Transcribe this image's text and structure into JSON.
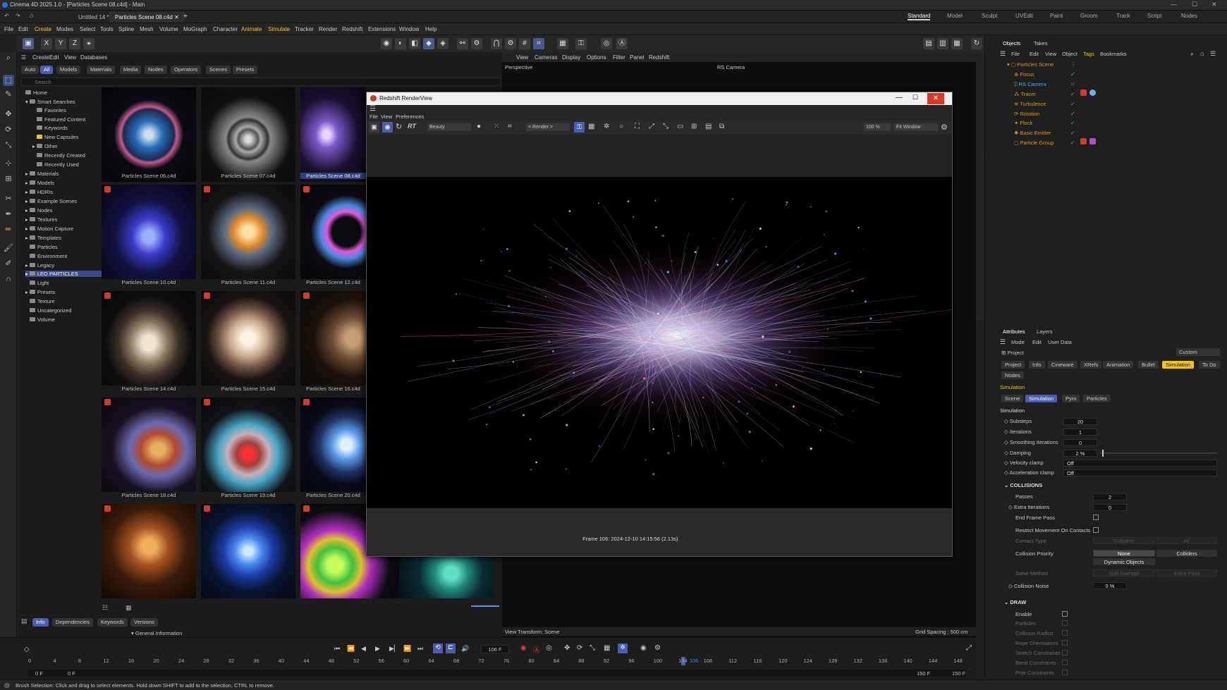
{
  "window": {
    "title": "Cinema 4D 2025.1.0 - [Particles Scene 08.c4d] - Main"
  },
  "doc_tabs": [
    "Untitled 14 *",
    "Particles Scene 08.c4d"
  ],
  "layouts": [
    "Standard",
    "Model",
    "Sculpt",
    "UVEdit",
    "Paint",
    "Groom",
    "Track",
    "Script",
    "Nodes"
  ],
  "menu": [
    "File",
    "Edit",
    "Create",
    "Modes",
    "Select",
    "Tools",
    "Spline",
    "Mesh",
    "Volume",
    "MoGraph",
    "Character",
    "Animate",
    "Simulate",
    "Tracker",
    "Render",
    "Redshift",
    "Extensions",
    "Window",
    "Help"
  ],
  "axis": {
    "x": "X",
    "y": "Y",
    "z": "Z"
  },
  "assets": {
    "menu": [
      "Create",
      "Edit",
      "View",
      "Databases"
    ],
    "filters": [
      "Auto",
      "All",
      "Models",
      "Materials",
      "Media",
      "Nodes",
      "Operators",
      "Scenes",
      "Presets"
    ],
    "search_placeholder": "Search",
    "tree": [
      "Home",
      "Smart Searches",
      "Favorites",
      "Featured Content",
      "Keywords",
      "New Capsules",
      "Other",
      "Recently Created",
      "Recently Used",
      "Materials",
      "Models",
      "HDRIs",
      "Example Scenes",
      "Nodes",
      "Textures",
      "Motion Capture",
      "Templates",
      "Particles",
      "Environment",
      "Legacy",
      "LEO PARTICLES",
      "Light",
      "Presets",
      "Texture",
      "Uncategorized",
      "Volume"
    ],
    "thumbs": [
      "Particles Scene 06.c4d",
      "Particles Scene 07.c4d",
      "Particles Scene 08.c4d",
      "Particles Scene 10.c4d",
      "Particles Scene 11.c4d",
      "Particles Scene 12.c4d",
      "Particles Scene 14.c4d",
      "Particles Scene 15.c4d",
      "Particles Scene 16.c4d",
      "Particles Scene 18.c4d",
      "Particles Scene 19.c4d",
      "Particles Scene 20.c4d"
    ],
    "info_tabs": [
      "Info",
      "Dependencies",
      "Keywords",
      "Versions"
    ],
    "general_info": "General Information"
  },
  "viewport": {
    "menu": [
      "View",
      "Cameras",
      "Display",
      "Options",
      "Filter",
      "Panel",
      "Redshift"
    ],
    "name": "Perspective",
    "camera": "RS Camera",
    "view_transform": "View Transform: Scene",
    "grid_spacing": "Grid Spacing : 500 cm"
  },
  "renderview": {
    "title": "Redshift RenderView",
    "menu": [
      "File",
      "View",
      "Preferences"
    ],
    "aov": "Beauty",
    "render_mode": "< Render >",
    "rt": "RT",
    "zoom": "100 %",
    "fit": "Fit Window",
    "frame_info": "Frame  106:  2024-12-10  14:15:56  (2.13s)"
  },
  "objects": {
    "tabs": [
      "Objects",
      "Takes"
    ],
    "menu": [
      "File",
      "Edit",
      "View",
      "Object",
      "Tags",
      "Bookmarks"
    ],
    "items": [
      "Particles Scene",
      "Focus",
      "RS Camera",
      "Tracer",
      "Turbulence",
      "Rotation",
      "Flock",
      "Basic Emitter",
      "Particle Group"
    ]
  },
  "attributes": {
    "tabs": [
      "Attributes",
      "Layers"
    ],
    "menu": [
      "Mode",
      "Edit",
      "User Data"
    ],
    "object": "Project",
    "preset": "Custom",
    "proj_tabs": [
      "Project",
      "Info",
      "Cineware",
      "XRefs",
      "Animation",
      "Bullet",
      "Simulation",
      "To Do",
      "Nodes"
    ],
    "section": "Simulation",
    "sub_tabs": [
      "Scene",
      "Simulation",
      "Pyro",
      "Particles"
    ],
    "group": "Simulation",
    "fields": [
      {
        "label": "Substeps",
        "value": "20"
      },
      {
        "label": "Iterations",
        "value": "1"
      },
      {
        "label": "Smoothing Iterations",
        "value": "0"
      },
      {
        "label": "Damping",
        "value": "2 %"
      },
      {
        "label": "Velocity clamp",
        "value": "Off"
      },
      {
        "label": "Acceleration clamp",
        "value": "Off"
      }
    ],
    "collisions": {
      "title": "COLLISIONS",
      "passes_label": "Passes",
      "passes": "2",
      "extra_label": "Extra Iterations",
      "extra": "0",
      "end_frame": "End Frame Pass",
      "restrict": "Restrict Movement On Contacts",
      "contact_type": "Contact Type",
      "ct_a": "Colliders",
      "ct_b": "All",
      "priority": "Collision Priority",
      "p_none": "None",
      "p_coll": "Colliders",
      "p_dyn": "Dynamic Objects",
      "solve": "Solve Method",
      "s_a": "Split Average",
      "s_b": "Extra Pass",
      "noise_label": "Collision Noise",
      "noise": "0 %"
    },
    "draw": {
      "title": "DRAW",
      "items": [
        "Enable",
        "Particles",
        "Collision Radius",
        "Rope Orientations",
        "Stretch Constraints",
        "Bend Constraints",
        "Pole Constraints"
      ]
    }
  },
  "timeline": {
    "current": "106 F",
    "start": "0 F",
    "start2": "0 F",
    "end": "150 F",
    "end2": "150 F",
    "playhead": "106",
    "ticks": [
      "0",
      "4",
      "8",
      "12",
      "16",
      "20",
      "24",
      "28",
      "32",
      "36",
      "40",
      "44",
      "48",
      "52",
      "56",
      "60",
      "64",
      "68",
      "72",
      "76",
      "80",
      "84",
      "88",
      "92",
      "96",
      "100",
      "104",
      "108",
      "112",
      "116",
      "120",
      "124",
      "128",
      "132",
      "136",
      "140",
      "144",
      "148"
    ]
  },
  "status": "Brush Selection: Click and drag to select elements. Hold down SHIFT to add to the selection, CTRL to remove.",
  "colors": {
    "accent": "#4b5db0",
    "active_tab": "#f0c420",
    "close": "#d9382a",
    "check": "#4bc24b"
  }
}
